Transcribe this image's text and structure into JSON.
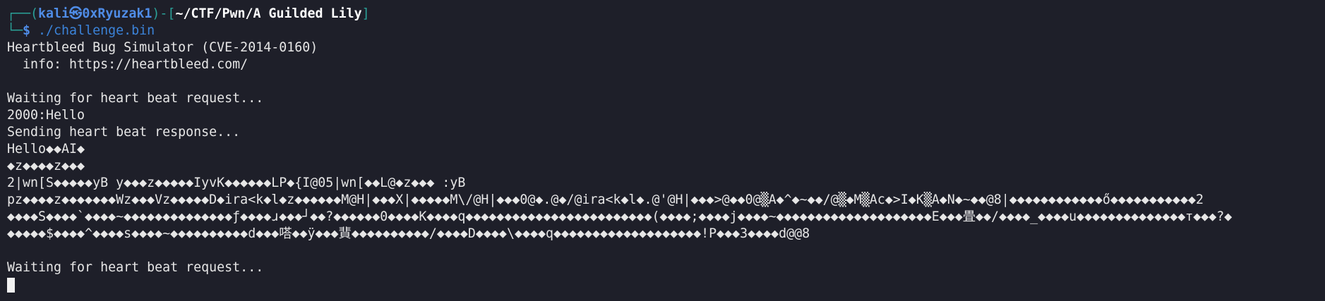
{
  "prompt": {
    "frame_top": "┌──(",
    "user": "kali㉿0xRyuzak1",
    "frame_mid": ")-[",
    "cwd": "~/CTF/Pwn/A Guilded Lily",
    "frame_end": "]",
    "frame_bottom": "└─",
    "dollar": "$",
    "command": " ./challenge.bin"
  },
  "output": {
    "lines": [
      "Heartbleed Bug Simulator (CVE-2014-0160)",
      "  info: https://heartbleed.com/",
      "",
      "Waiting for heart beat request...",
      "2000:Hello",
      "Sending heart beat response...",
      "Hello◆◆AI◆",
      "◆z◆◆◆◆z◆◆◆",
      "2|wn[S◆◆◆◆◆yB y◆◆◆z◆◆◆◆◆IyvK◆◆◆◆◆◆LP◆{I@05|wn[◆◆L@◆z◆◆◆ :yB",
      "pz◆◆◆◆z◆◆◆◆◆◆◆Wz◆◆◆Vz◆◆◆◆◆D◆ira<k◆l◆z◆◆◆◆◆◆M@H|◆◆◆X|◆◆◆◆◆M\\/@H|◆◆◆0@◆.@◆/@ira<k◆l◆.@'@H|◆◆◆>@◆◆0@▒A◆^◆~◆◆/@▒◆M▒Ac◆>I◆K▒A◆N◆~◆◆@8|◆◆◆◆◆◆◆◆◆◆◆◆ő◆◆◆◆◆◆◆◆◆◆◆2",
      "◆◆◆◆S◆◆◆◆`◆◆◆◆~◆◆◆◆◆◆◆◆◆◆◆◆◆◆ƒ◆◆◆◆ɹ◆◆◆┘◆◆?◆◆◆◆◆◆0◆◆◆◆K◆◆◆◆q◆◆◆◆◆◆◆◆◆◆◆◆◆◆◆◆◆◆◆◆◆◆◆◆(◆◆◆◆;◆◆◆◆j◆◆◆◆~◆◆◆◆◆◆◆◆◆◆◆◆◆◆◆◆◆◆◆◆E◆◆◆畳◆◆/◆◆◆◆_◆◆◆◆u◆◆◆◆◆◆◆◆◆◆◆◆◆◆ᴛ◆◆◆?◆",
      "◆◆◆◆◆$◆◆◆◆^◆◆◆◆s◆◆◆◆~◆◆◆◆◆◆◆◆◆◆d◆◆◆嗒◆◆ÿ◆◆◆䩀◆◆◆◆◆◆◆◆◆◆/◆◆◆◆D◆◆◆◆\\◆◆◆◆q◆◆◆◆◆◆◆◆◆◆◆◆◆◆◆◆◆◆◆!P◆◆◆3◆◆◆◆d@@8",
      "",
      "Waiting for heart beat request..."
    ]
  }
}
